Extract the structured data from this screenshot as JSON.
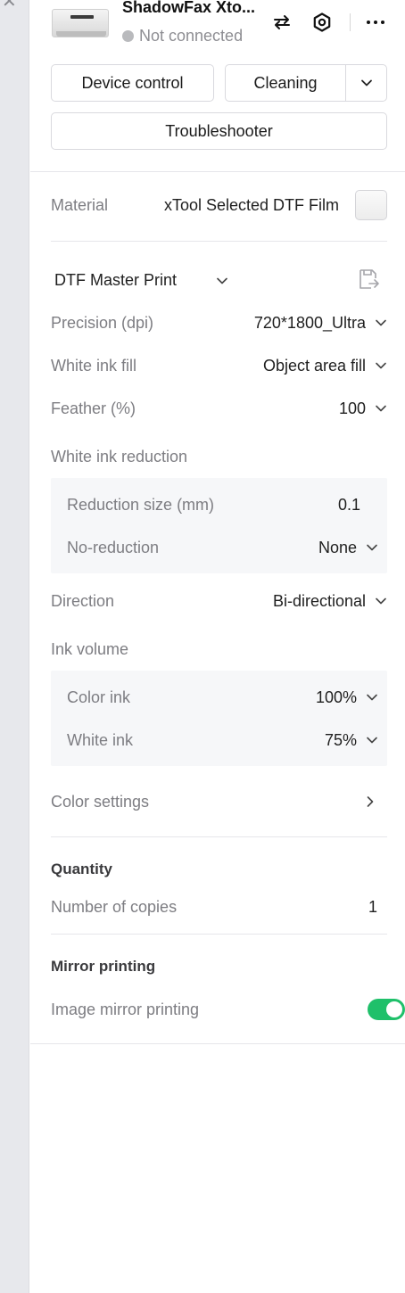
{
  "device": {
    "name": "ShadowFax Xto...",
    "status": "Not connected"
  },
  "buttons": {
    "device_control": "Device control",
    "cleaning": "Cleaning",
    "troubleshooter": "Troubleshooter"
  },
  "material": {
    "label": "Material",
    "value": "xTool Selected DTF Film"
  },
  "preset": {
    "value": "DTF Master Print"
  },
  "settings": {
    "precision": {
      "label": "Precision (dpi)",
      "value": "720*1800_Ultra"
    },
    "white_ink_fill": {
      "label": "White ink fill",
      "value": "Object area fill"
    },
    "feather": {
      "label": "Feather (%)",
      "value": "100"
    },
    "white_ink_reduction": "White ink reduction",
    "reduction_size": {
      "label": "Reduction size (mm)",
      "value": "0.1"
    },
    "no_reduction": {
      "label": "No-reduction",
      "value": "None"
    },
    "direction": {
      "label": "Direction",
      "value": "Bi-directional"
    },
    "ink_volume": "Ink volume",
    "color_ink": {
      "label": "Color ink",
      "value": "100%"
    },
    "white_ink": {
      "label": "White ink",
      "value": "75%"
    },
    "color_settings": "Color settings"
  },
  "quantity": {
    "title": "Quantity",
    "copies_label": "Number of copies",
    "copies_value": "1"
  },
  "mirror": {
    "title": "Mirror printing",
    "label": "Image mirror printing",
    "enabled": true
  },
  "colors": {
    "toggle_on": "#1fc06a",
    "label_gray": "#7d7d82",
    "sub_bg": "#f6f7f9"
  }
}
